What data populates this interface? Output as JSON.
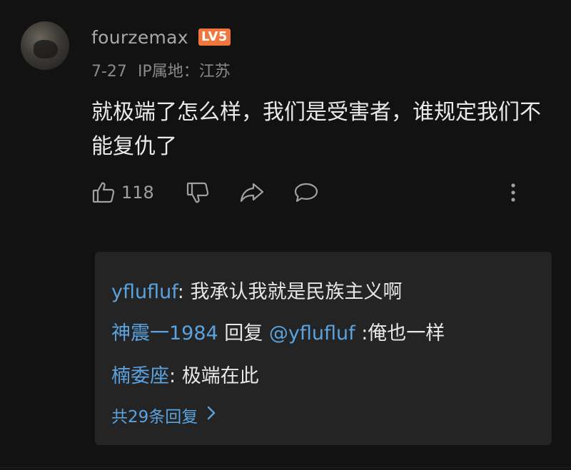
{
  "comment": {
    "username": "fourzemax",
    "level": "LV5",
    "date": "7-27",
    "ip_location": "IP属地：江苏",
    "text": "就极端了怎么样，我们是受害者，谁规定我们不能复仇了",
    "like_count": "118",
    "icons": [
      "like-icon",
      "dislike-icon",
      "share-icon",
      "reply-icon",
      "more-icon"
    ]
  },
  "replies": [
    {
      "author": "yflufluf",
      "separator": ": ",
      "text": "我承认我就是民族主义啊"
    },
    {
      "author": "神震一1984",
      "reply_word": " 回复 ",
      "mention": "@yflufluf",
      "text": " :俺也一样"
    },
    {
      "author": "楠委座",
      "separator": ": ",
      "text": "极端在此"
    }
  ],
  "more_replies_label": "共29条回复",
  "colors": {
    "background": "#121212",
    "reply_box": "#242424",
    "link_blue": "#5aa3e0",
    "badge_orange": "#f2763b"
  }
}
